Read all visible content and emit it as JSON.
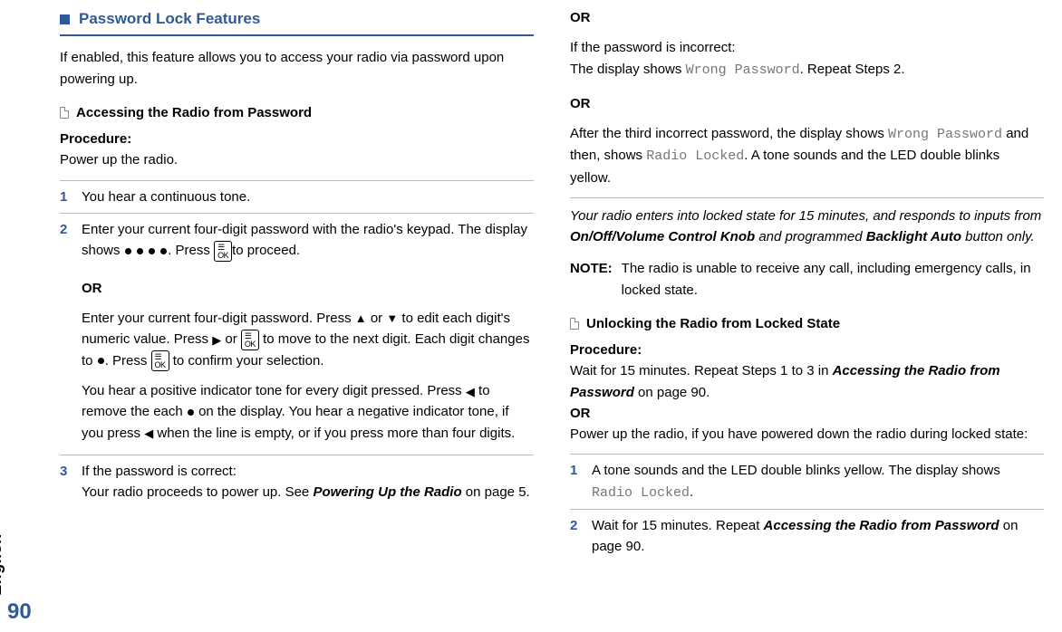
{
  "meta": {
    "page_number": "90",
    "lang_tab": "English"
  },
  "left": {
    "section_title": "Password Lock Features",
    "intro": "If enabled, this feature allows you to access your radio via password upon powering up.",
    "sub1": "Accessing the Radio from Password",
    "proc_label": "Procedure:",
    "proc_text": "Power up the radio.",
    "steps": {
      "s1": "You hear a continuous tone.",
      "s2a": "Enter your current four-digit password with the radio's keypad. The display shows ",
      "s2b": ". Press ",
      "s2c": "to proceed.",
      "or": "OR",
      "s2alt_a": "Enter your current four-digit password. Press ",
      "s2alt_b": " or ",
      "s2alt_c": " to edit each digit's numeric value. Press ",
      "s2alt_d": " or ",
      "s2alt_e": " to move to the next digit. Each digit changes to ",
      "s2alt_f": ". Press ",
      "s2alt_g": " to confirm your selection.",
      "s2tone_a": "You hear a positive indicator tone for every digit pressed. Press ",
      "s2tone_b": " to remove the each ",
      "s2tone_c": " on the display. You hear a negative indicator tone, if you press ",
      "s2tone_d": " when the line is empty, or if you press more than four digits.",
      "s3a": "If the password is correct:",
      "s3b": "Your radio proceeds to power up. See ",
      "s3c": "Powering Up the Radio",
      "s3d": " on page 5."
    },
    "key_ok": "☰\nOK"
  },
  "right": {
    "or1": "OR",
    "inc_a": "If the password is incorrect:",
    "inc_b": "The display shows ",
    "inc_c": "Wrong Password",
    "inc_d": ". Repeat Steps 2.",
    "or2": "OR",
    "third_a": "After the third incorrect password, the display shows ",
    "third_b": "Wrong Password",
    "third_c": " and then, shows ",
    "third_d": "Radio Locked",
    "third_e": ". A tone sounds and the LED double blinks yellow.",
    "locked_a": "Your radio enters into locked state for 15 minutes, and responds to inputs from ",
    "locked_b": "On/Off/Volume Control Knob",
    "locked_c": " and programmed ",
    "locked_d": "Backlight Auto",
    "locked_e": " button only.",
    "note_label": "NOTE:",
    "note_text": "The radio is unable to receive any call, including emergency calls, in locked state.",
    "sub2": "Unlocking the Radio from Locked State",
    "proc_label2": "Procedure:",
    "proc2_a": "Wait for 15 minutes. Repeat Steps 1 to 3 in ",
    "proc2_b": "Accessing the Radio from Password",
    "proc2_c": " on page 90.",
    "or3": "OR",
    "proc2_pwr": "Power up the radio, if you have powered down the radio during locked state:",
    "steps2": {
      "s1a": "A tone sounds and the LED double blinks yellow. The display shows ",
      "s1b": "Radio Locked",
      "s1c": ".",
      "s2a": "Wait for 15 minutes. Repeat ",
      "s2b": "Accessing the Radio from Password",
      "s2c": " on page 90."
    }
  }
}
